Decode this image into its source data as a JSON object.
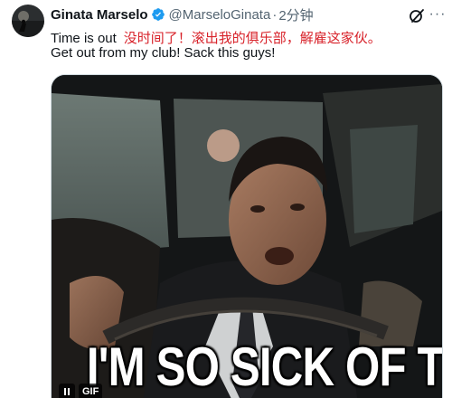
{
  "tweet": {
    "author_name": "Ginata Marselo",
    "handle": "@MarseloGinata",
    "separator": "·",
    "time": "2分钟",
    "text_en_1": "Time is out",
    "text_zh": "没时间了！滚出我的俱乐部，解雇这家伙。",
    "text_en_2": "Get out from my club! Sack this guys!",
    "verified_color": "#1d9bf0"
  },
  "media": {
    "caption": "I'M SO SICK OF THIS",
    "badge": "GIF",
    "pause_icon": "pause-icon"
  },
  "icons": {
    "avatar": "avatar",
    "verified": "verified-badge-icon",
    "grok": "grok-icon",
    "more": "more-icon"
  }
}
